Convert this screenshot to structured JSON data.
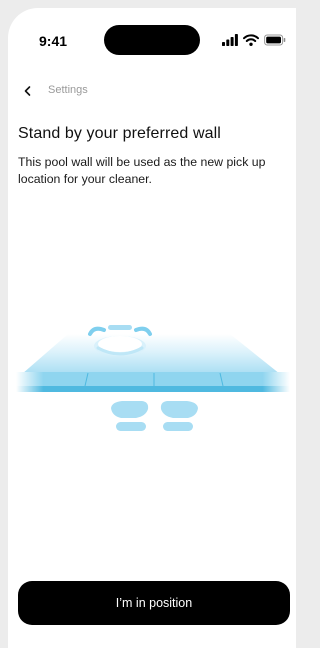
{
  "status_bar": {
    "time": "9:41",
    "icons": [
      "signal-icon",
      "wifi-icon",
      "battery-icon"
    ]
  },
  "nav": {
    "back_icon": "chevron-left-icon",
    "label": "Settings"
  },
  "content": {
    "title": "Stand by your preferred wall",
    "description": "This pool wall will be used as the new pick up location for your cleaner."
  },
  "illustration": {
    "icons": [
      "pool-cleaner-icon",
      "pool-floor",
      "footprints-icon"
    ],
    "colors": {
      "water_light": "#dff3fb",
      "water_mid": "#9fdaf1",
      "wall": "#7fd0ee",
      "wall_dark": "#4fb9e0",
      "feet": "#a8ddf3"
    }
  },
  "cta": {
    "label": "I’m in position"
  },
  "colors": {
    "background": "#ffffff",
    "button": "#000000",
    "button_text": "#ffffff",
    "muted_text": "#9a9a9a"
  }
}
